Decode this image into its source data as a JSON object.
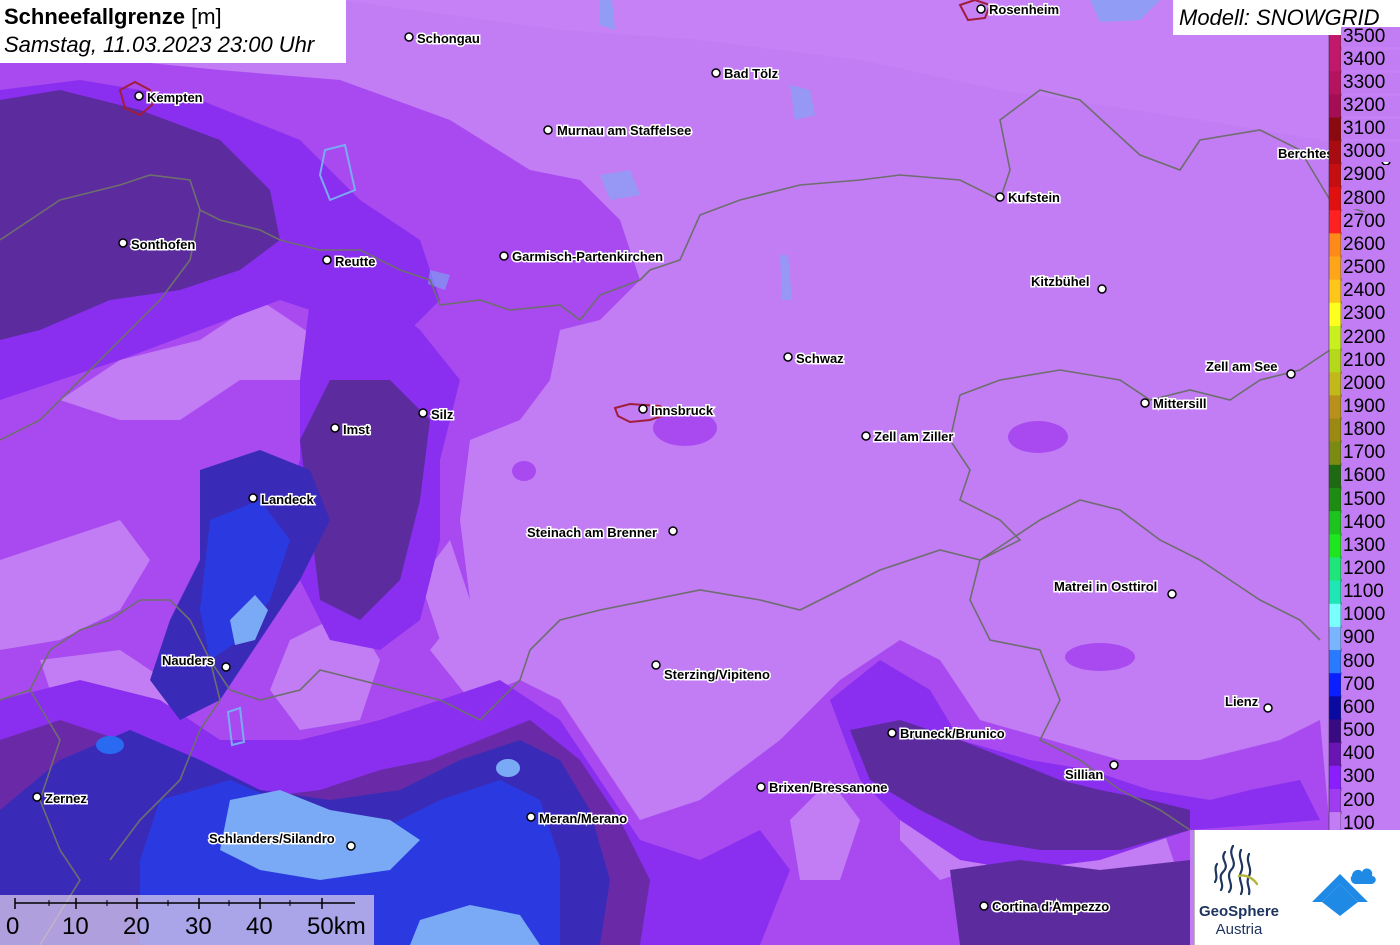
{
  "title": {
    "variable": "Schneefallgrenze",
    "unit": "[m]",
    "datetime": "Samstag, 11.03.2023 23:00 Uhr"
  },
  "model_label": "Modell: SNOWGRID",
  "legend": {
    "items": [
      {
        "label": "3500",
        "color": "#c2186b"
      },
      {
        "label": "3400",
        "color": "#c2186b"
      },
      {
        "label": "3300",
        "color": "#b5125f"
      },
      {
        "label": "3200",
        "color": "#a50e55"
      },
      {
        "label": "3100",
        "color": "#8b0a10"
      },
      {
        "label": "3000",
        "color": "#a80c10"
      },
      {
        "label": "2900",
        "color": "#c40e10"
      },
      {
        "label": "2800",
        "color": "#e01010"
      },
      {
        "label": "2700",
        "color": "#ff2020"
      },
      {
        "label": "2600",
        "color": "#ff8a1a"
      },
      {
        "label": "2500",
        "color": "#ffa51a"
      },
      {
        "label": "2400",
        "color": "#ffc61a"
      },
      {
        "label": "2300",
        "color": "#ffff1e"
      },
      {
        "label": "2200",
        "color": "#c8f01e"
      },
      {
        "label": "2100",
        "color": "#b4d81a"
      },
      {
        "label": "2000",
        "color": "#c3b81a"
      },
      {
        "label": "1900",
        "color": "#b8901a"
      },
      {
        "label": "1800",
        "color": "#9a8a12"
      },
      {
        "label": "1700",
        "color": "#7a8a12"
      },
      {
        "label": "1600",
        "color": "#1e6a12"
      },
      {
        "label": "1500",
        "color": "#1e8c12"
      },
      {
        "label": "1400",
        "color": "#1ec41e"
      },
      {
        "label": "1300",
        "color": "#1ee61e"
      },
      {
        "label": "1200",
        "color": "#1ee67a"
      },
      {
        "label": "1100",
        "color": "#1ee6b4"
      },
      {
        "label": "1000",
        "color": "#7affff"
      },
      {
        "label": "900",
        "color": "#7ab4ff"
      },
      {
        "label": "800",
        "color": "#2a7aff"
      },
      {
        "label": "700",
        "color": "#0a1eff"
      },
      {
        "label": "600",
        "color": "#0a0aa0"
      },
      {
        "label": "500",
        "color": "#3a0a82"
      },
      {
        "label": "400",
        "color": "#6a14b4"
      },
      {
        "label": "300",
        "color": "#8a1eff"
      },
      {
        "label": "200",
        "color": "#a03cf0"
      },
      {
        "label": "100",
        "color": "#c27df5"
      }
    ]
  },
  "cities": [
    {
      "name": "Rosenheim"
    },
    {
      "name": "Schongau"
    },
    {
      "name": "Bad Tölz"
    },
    {
      "name": "Kempten"
    },
    {
      "name": "Murnau am Staffelsee"
    },
    {
      "name": "Berchtesgaden"
    },
    {
      "name": "Kufstein"
    },
    {
      "name": "Sonthofen"
    },
    {
      "name": "Reutte"
    },
    {
      "name": "Garmisch-Partenkirchen"
    },
    {
      "name": "Kitzbühel"
    },
    {
      "name": "Schwaz"
    },
    {
      "name": "Zell am See"
    },
    {
      "name": "Mittersill"
    },
    {
      "name": "Silz"
    },
    {
      "name": "Innsbruck"
    },
    {
      "name": "Imst"
    },
    {
      "name": "Zell am Ziller"
    },
    {
      "name": "Landeck"
    },
    {
      "name": "Steinach am Brenner"
    },
    {
      "name": "Matrei in Osttirol"
    },
    {
      "name": "Nauders"
    },
    {
      "name": "Sterzing/Vipiteno"
    },
    {
      "name": "Lienz"
    },
    {
      "name": "Bruneck/Brunico"
    },
    {
      "name": "Sillian"
    },
    {
      "name": "Brixen/Bressanone"
    },
    {
      "name": "Zernez"
    },
    {
      "name": "Meran/Merano"
    },
    {
      "name": "Schlanders/Silandro"
    },
    {
      "name": "Cortina d'Ampezzo"
    }
  ],
  "scale_bar": {
    "ticks": [
      "0",
      "10",
      "20",
      "30",
      "40",
      "50km"
    ]
  },
  "logos": {
    "geosphere_line1": "GeoSphere",
    "geosphere_line2": "Austria"
  },
  "colors": {
    "base": "#c27df5",
    "level_200": "#a84af0",
    "level_300": "#8a2ef0",
    "level_400": "#6a2aa8",
    "level_500": "#4a2a9a",
    "level_600": "#3a2ab8",
    "level_700": "#2a3ae0",
    "level_800": "#3a6af0",
    "level_900": "#7aaaf5",
    "border": "#6e6e6e"
  }
}
